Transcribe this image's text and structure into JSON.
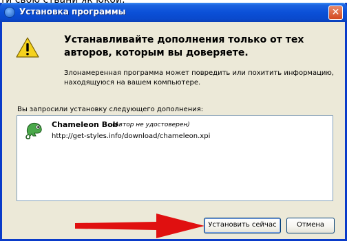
{
  "background_text": "ти свою стьани як юкой.",
  "dialog": {
    "title": "Установка программы",
    "close_label": "✕",
    "heading": "Устанавливайте дополнения только от тех авторов, которым вы доверяете.",
    "warning": "Злонамеренная программа может повредить или похитить информацию, находящуюся на вашем компьютере.",
    "list_label": "Вы запросили установку следующего дополнения:",
    "addon": {
      "name": "Chameleon Bob",
      "note": "(Автор не удостоверен)",
      "url": "http://get-styles.info/download/chameleon.xpi",
      "icon": "chameleon-icon"
    },
    "buttons": {
      "install": "Установить сейчас",
      "cancel": "Отмена"
    }
  },
  "colors": {
    "titlebar": "#0b50d8",
    "window_bg": "#ece9d8",
    "arrow": "#e01010",
    "warning_fill": "#f5d21e"
  },
  "icons": {
    "title": "firefox-icon",
    "warning": "warning-icon",
    "close": "close-icon",
    "annotation": "red-arrow"
  }
}
